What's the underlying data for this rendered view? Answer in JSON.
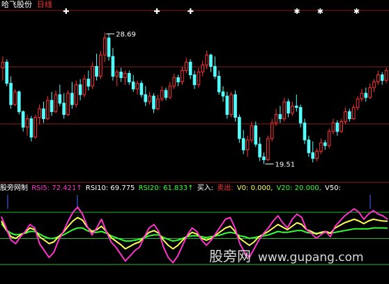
{
  "header": {
    "stock_name": "哈飞股份",
    "period": "日线",
    "high_label": "28.69",
    "low_label": "19.51",
    "star_glyph": "✱",
    "cross_glyph": "✚"
  },
  "indicator_bar": {
    "name": "股旁网制",
    "rsi5": "RSI5: 72.421↑",
    "rsi10": "RSI10: 69.775",
    "rsi20": "RSI20: 61.833↑",
    "buy": "买入:",
    "sell": "卖出:",
    "v0": "V0: 0.000,",
    "v20": "V20: 20.000,",
    "v50": "V50:"
  },
  "watermark": {
    "text": "股旁网",
    "url": "www.gupang.com"
  },
  "colors": {
    "up": "#ff3333",
    "down": "#54ffff",
    "grid": "#8b1a1a",
    "rsi5": "#ff33cc",
    "rsi10": "#ffff55",
    "rsi20": "#33ff33",
    "level_line": "#22bb22",
    "marker_line": "#4a6cff"
  },
  "chart_data": {
    "type": "candlestick",
    "title": "哈飞股份 日线",
    "price_ylim": [
      18.3,
      30.3
    ],
    "rsi_ylim": [
      0,
      100
    ],
    "annotations": [
      {
        "text": "28.69",
        "kind": "period-high",
        "value": 28.69
      },
      {
        "text": "19.51",
        "kind": "period-low",
        "value": 19.51
      }
    ],
    "candles": [
      [
        26.2,
        27.0,
        25.3,
        26.6
      ],
      [
        26.6,
        26.8,
        24.9,
        25.1
      ],
      [
        25.1,
        25.6,
        23.3,
        23.6
      ],
      [
        23.6,
        24.7,
        23.5,
        24.5
      ],
      [
        24.5,
        24.6,
        22.9,
        23.1
      ],
      [
        23.1,
        23.2,
        21.7,
        22.0
      ],
      [
        22.0,
        22.9,
        21.4,
        22.6
      ],
      [
        22.6,
        22.8,
        21.0,
        21.3
      ],
      [
        21.3,
        22.9,
        21.2,
        22.7
      ],
      [
        22.7,
        23.6,
        22.2,
        23.3
      ],
      [
        23.3,
        23.8,
        22.3,
        22.6
      ],
      [
        22.6,
        24.2,
        22.5,
        23.9
      ],
      [
        23.9,
        24.5,
        22.8,
        23.1
      ],
      [
        23.1,
        24.6,
        23.0,
        24.3
      ],
      [
        24.3,
        25.0,
        23.5,
        23.7
      ],
      [
        23.7,
        24.4,
        22.6,
        22.9
      ],
      [
        22.9,
        24.6,
        22.8,
        24.4
      ],
      [
        24.4,
        25.2,
        23.3,
        23.6
      ],
      [
        23.6,
        25.3,
        23.4,
        25.0
      ],
      [
        25.0,
        25.4,
        23.9,
        24.3
      ],
      [
        24.3,
        25.7,
        24.1,
        25.4
      ],
      [
        25.4,
        26.0,
        24.6,
        24.9
      ],
      [
        24.9,
        26.6,
        24.7,
        26.3
      ],
      [
        26.3,
        27.2,
        25.3,
        25.6
      ],
      [
        25.6,
        27.4,
        25.4,
        27.1
      ],
      [
        27.1,
        28.69,
        26.6,
        28.3
      ],
      [
        28.3,
        28.6,
        26.7,
        27.0
      ],
      [
        27.0,
        27.6,
        25.3,
        25.6
      ],
      [
        25.6,
        26.1,
        24.9,
        25.9
      ],
      [
        25.9,
        26.2,
        25.2,
        25.5
      ],
      [
        25.5,
        26.0,
        25.0,
        25.8
      ],
      [
        25.8,
        26.0,
        25.0,
        25.2
      ],
      [
        25.2,
        25.7,
        24.5,
        24.7
      ],
      [
        24.7,
        25.3,
        24.3,
        25.1
      ],
      [
        25.1,
        25.3,
        24.1,
        24.3
      ],
      [
        24.3,
        24.9,
        23.5,
        23.8
      ],
      [
        23.8,
        24.5,
        23.6,
        24.2
      ],
      [
        24.2,
        24.4,
        23.0,
        23.3
      ],
      [
        23.3,
        24.3,
        23.2,
        24.0
      ],
      [
        24.0,
        24.9,
        23.8,
        24.6
      ],
      [
        24.6,
        24.8,
        23.9,
        24.1
      ],
      [
        24.1,
        25.2,
        24.0,
        24.9
      ],
      [
        24.9,
        25.8,
        24.7,
        25.5
      ],
      [
        25.5,
        25.7,
        24.9,
        25.2
      ],
      [
        25.2,
        26.3,
        25.0,
        26.0
      ],
      [
        26.0,
        26.9,
        25.8,
        26.6
      ],
      [
        26.6,
        26.8,
        25.4,
        25.7
      ],
      [
        25.7,
        26.0,
        24.7,
        25.0
      ],
      [
        25.0,
        26.2,
        24.8,
        25.9
      ],
      [
        25.9,
        26.7,
        25.6,
        26.4
      ],
      [
        26.4,
        27.4,
        26.1,
        27.1
      ],
      [
        27.1,
        27.2,
        25.9,
        26.3
      ],
      [
        26.3,
        27.0,
        25.4,
        25.6
      ],
      [
        25.6,
        26.0,
        24.3,
        24.5
      ],
      [
        24.5,
        24.9,
        23.8,
        24.2
      ],
      [
        24.2,
        24.5,
        22.6,
        22.9
      ],
      [
        22.9,
        24.5,
        22.7,
        24.3
      ],
      [
        24.3,
        24.6,
        22.4,
        22.7
      ],
      [
        22.7,
        22.9,
        20.9,
        21.2
      ],
      [
        21.2,
        21.8,
        20.1,
        20.4
      ],
      [
        20.4,
        21.4,
        19.9,
        21.1
      ],
      [
        21.1,
        22.4,
        20.9,
        22.1
      ],
      [
        22.1,
        22.4,
        20.6,
        20.8
      ],
      [
        20.8,
        21.3,
        19.6,
        19.9
      ],
      [
        19.9,
        20.2,
        19.4,
        19.7
      ],
      [
        19.7,
        21.4,
        19.6,
        21.2
      ],
      [
        21.2,
        22.6,
        21.0,
        22.3
      ],
      [
        22.3,
        23.3,
        22.1,
        22.9
      ],
      [
        22.9,
        23.5,
        22.3,
        22.6
      ],
      [
        22.6,
        24.1,
        22.4,
        23.8
      ],
      [
        23.8,
        24.0,
        22.7,
        23.0
      ],
      [
        23.0,
        23.8,
        22.8,
        23.5
      ],
      [
        23.5,
        24.3,
        23.1,
        23.4
      ],
      [
        23.4,
        23.6,
        22.0,
        22.3
      ],
      [
        22.3,
        22.6,
        20.8,
        21.1
      ],
      [
        21.1,
        21.4,
        19.9,
        20.2
      ],
      [
        20.2,
        21.0,
        19.51,
        19.8
      ],
      [
        19.8,
        20.5,
        19.6,
        20.3
      ],
      [
        20.3,
        21.2,
        20.1,
        20.9
      ],
      [
        20.9,
        21.1,
        20.4,
        20.7
      ],
      [
        20.7,
        21.9,
        20.5,
        21.7
      ],
      [
        21.7,
        22.6,
        21.5,
        22.3
      ],
      [
        22.3,
        22.5,
        21.4,
        21.7
      ],
      [
        21.7,
        22.6,
        21.6,
        22.4
      ],
      [
        22.4,
        23.4,
        22.2,
        23.1
      ],
      [
        23.1,
        23.3,
        22.4,
        22.6
      ],
      [
        22.6,
        23.6,
        22.5,
        23.4
      ],
      [
        23.4,
        24.2,
        23.2,
        24.0
      ],
      [
        24.0,
        24.7,
        23.8,
        24.4
      ],
      [
        24.4,
        24.8,
        23.8,
        24.1
      ],
      [
        24.1,
        25.1,
        24.0,
        24.8
      ],
      [
        24.8,
        25.4,
        24.5,
        25.2
      ],
      [
        25.2,
        26.0,
        25.0,
        25.7
      ],
      [
        25.7,
        25.9,
        25.0,
        25.3
      ],
      [
        25.3,
        26.2,
        25.1,
        26.0
      ]
    ],
    "markers": [
      {
        "kind": "cross",
        "index": 25,
        "text": "✚"
      },
      {
        "kind": "cross",
        "index": 60,
        "text": "✚"
      },
      {
        "kind": "cross",
        "index": 73,
        "text": "✚"
      },
      {
        "kind": "star",
        "index": 114,
        "text": "✱"
      },
      {
        "kind": "star",
        "index": 123,
        "text": "✱"
      },
      {
        "kind": "star",
        "index": 137,
        "text": "✱"
      }
    ],
    "rsi_levels": [
      20,
      50,
      80
    ],
    "rsi_series": [
      {
        "name": "RSI5",
        "values": [
          75,
          62,
          48,
          44,
          52,
          58,
          66,
          62,
          44,
          36,
          28,
          34,
          48,
          58,
          70,
          80,
          86,
          78,
          64,
          54,
          62,
          72,
          58,
          46,
          40,
          32,
          24,
          30,
          36,
          40,
          52,
          62,
          66,
          58,
          40,
          28,
          22,
          30,
          42,
          54,
          62,
          58,
          48,
          42,
          48,
          56,
          64,
          72,
          74,
          62,
          44,
          34,
          28,
          38,
          48,
          56,
          62,
          70,
          76,
          68,
          62,
          72,
          78,
          74,
          60,
          56,
          50,
          54,
          58,
          52,
          64,
          70,
          76,
          80,
          84,
          80,
          72,
          78,
          82,
          78,
          76,
          72
        ]
      },
      {
        "name": "RSI10",
        "values": [
          70,
          60,
          52,
          50,
          54,
          57,
          62,
          60,
          52,
          48,
          44,
          46,
          52,
          57,
          64,
          70,
          74,
          71,
          63,
          58,
          60,
          64,
          58,
          51,
          47,
          43,
          38,
          41,
          44,
          46,
          52,
          57,
          59,
          56,
          48,
          42,
          38,
          42,
          48,
          53,
          57,
          55,
          50,
          48,
          50,
          54,
          58,
          62,
          64,
          58,
          50,
          46,
          42,
          46,
          52,
          55,
          58,
          62,
          66,
          63,
          60,
          64,
          68,
          66,
          60,
          58,
          55,
          57,
          58,
          56,
          62,
          65,
          68,
          70,
          72,
          70,
          67,
          70,
          72,
          71,
          70,
          69.8
        ]
      },
      {
        "name": "RSI20",
        "values": [
          67,
          60,
          56,
          54,
          55,
          56,
          58,
          58,
          55,
          52,
          50,
          50,
          52,
          54,
          57,
          60,
          62,
          62,
          59,
          57,
          57,
          58,
          56,
          53,
          51,
          49,
          47,
          47,
          48,
          49,
          51,
          53,
          54,
          54,
          51,
          49,
          47,
          48,
          50,
          52,
          53,
          53,
          52,
          51,
          52,
          53,
          54,
          56,
          57,
          56,
          53,
          52,
          50,
          51,
          52,
          53,
          54,
          56,
          58,
          57,
          57,
          58,
          59,
          59,
          57,
          56,
          56,
          56,
          57,
          56,
          57,
          58,
          59,
          60,
          61,
          61,
          61,
          61,
          62,
          62,
          62,
          61.8
        ]
      }
    ]
  }
}
